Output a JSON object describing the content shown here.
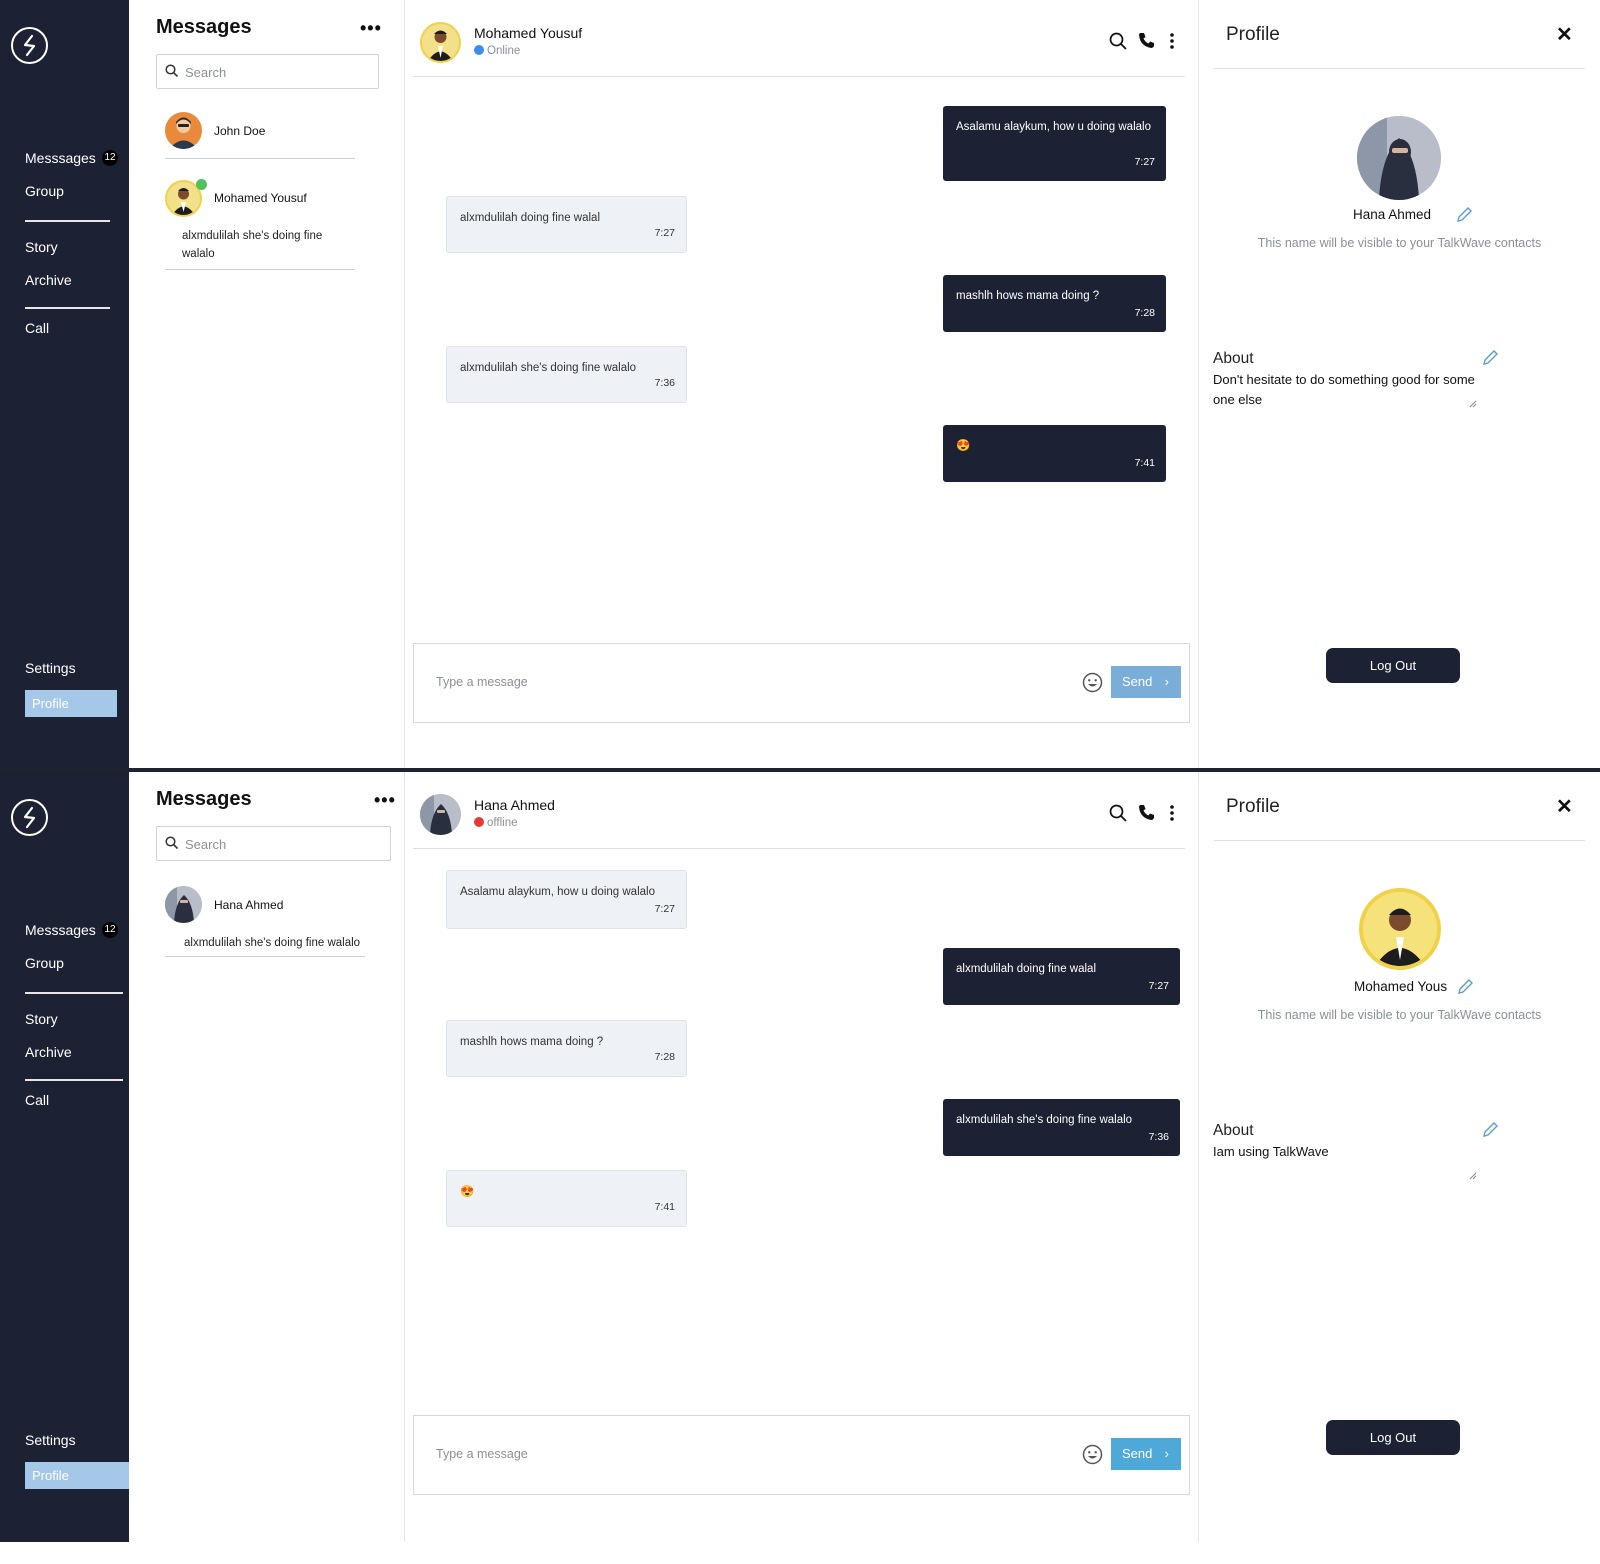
{
  "screens": [
    {
      "sidebar": {
        "messages_label": "Messsages",
        "messages_badge": "12",
        "group_label": "Group",
        "story_label": "Story",
        "archive_label": "Archive",
        "call_label": "Call",
        "settings_label": "Settings",
        "profile_label": "Profile"
      },
      "list": {
        "title": "Messages",
        "more_label": "•••",
        "search_placeholder": "Search",
        "contacts": [
          {
            "name": "John Doe",
            "preview": ""
          },
          {
            "name": "Mohamed Yousuf",
            "preview": "alxmdulilah she's doing fine walalo"
          }
        ]
      },
      "chat": {
        "name": "Mohamed Yousuf",
        "status": "Online",
        "status_color": "#3b8de8",
        "messages": [
          {
            "dir": "out",
            "text": "Asalamu alaykum, how u doing walalo",
            "time": "7:27"
          },
          {
            "dir": "in",
            "text": "alxmdulilah doing fine walal",
            "time": "7:27"
          },
          {
            "dir": "out",
            "text": "mashlh hows mama doing ?",
            "time": "7:28"
          },
          {
            "dir": "in",
            "text": "alxmdulilah she's doing fine walalo",
            "time": "7:36"
          },
          {
            "dir": "out",
            "text": "😍",
            "time": "7:41"
          }
        ],
        "composer_placeholder": "Type a message",
        "send_label": "Send",
        "send_chevron": "›"
      },
      "profile": {
        "title": "Profile",
        "close": "✕",
        "name": "Hana Ahmed",
        "hint": "This name will be visible to your TalkWave contacts",
        "about_label": "About",
        "about_text": "Don't hesitate to do something good for some one else",
        "logout_label": "Log Out"
      }
    },
    {
      "sidebar": {
        "messages_label": "Messsages",
        "messages_badge": "12",
        "group_label": "Group",
        "story_label": "Story",
        "archive_label": "Archive",
        "call_label": "Call",
        "settings_label": "Settings",
        "profile_label": "Profile"
      },
      "list": {
        "title": "Messages",
        "more_label": "•••",
        "search_placeholder": "Search",
        "contacts": [
          {
            "name": "Hana Ahmed",
            "preview": "alxmdulilah she's doing fine walalo"
          }
        ]
      },
      "chat": {
        "name": "Hana Ahmed",
        "status": "offline",
        "status_color": "#e53935",
        "messages": [
          {
            "dir": "in",
            "text": "Asalamu alaykum, how u doing walalo",
            "time": "7:27"
          },
          {
            "dir": "out",
            "text": "alxmdulilah doing fine walal",
            "time": "7:27"
          },
          {
            "dir": "in",
            "text": "mashlh hows mama doing ?",
            "time": "7:28"
          },
          {
            "dir": "out",
            "text": "alxmdulilah she's doing fine walalo",
            "time": "7:36"
          },
          {
            "dir": "in",
            "text": "😍",
            "time": "7:41"
          }
        ],
        "composer_placeholder": "Type a message",
        "send_label": "Send",
        "send_chevron": "›"
      },
      "profile": {
        "title": "Profile",
        "close": "✕",
        "name": "Mohamed Yousuf",
        "hint": "This name will be visible to your TalkWave contacts",
        "about_label": "About",
        "about_text": "Iam using TalkWave",
        "logout_label": "Log Out"
      }
    }
  ],
  "colors": {
    "sidebar_bg": "#1c2233",
    "accent_blue": "#7aaed8",
    "profile_active": "#a5c8e8",
    "online_green": "#4fc15f"
  }
}
